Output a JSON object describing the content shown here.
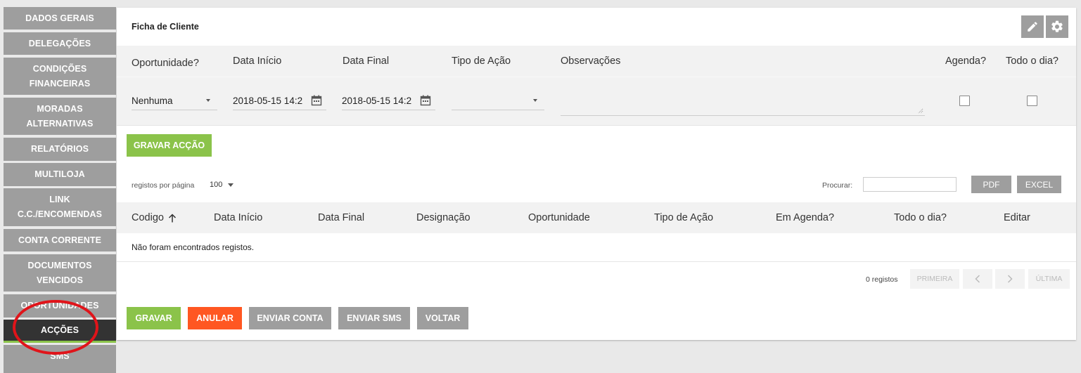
{
  "sidebar": {
    "items": [
      {
        "label": "DADOS GERAIS"
      },
      {
        "label": "DELEGAÇÕES"
      },
      {
        "label": "CONDIÇÕES FINANCEIRAS"
      },
      {
        "label": "MORADAS ALTERNATIVAS"
      },
      {
        "label": "RELATÓRIOS"
      },
      {
        "label": "MULTILOJA"
      },
      {
        "label": "LINK C.C./ENCOMENDAS"
      },
      {
        "label": "CONTA CORRENTE"
      },
      {
        "label": "DOCUMENTOS VENCIDOS"
      },
      {
        "label": "OPORTUNIDADES"
      },
      {
        "label": "ACÇÕES"
      },
      {
        "label": "SMS"
      }
    ]
  },
  "card": {
    "title": "Ficha de Cliente"
  },
  "form": {
    "headers": {
      "oportunidade": "Oportunidade?",
      "data_inicio": "Data Início",
      "data_final": "Data Final",
      "tipo_acao": "Tipo de Ação",
      "observacoes": "Observações",
      "agenda": "Agenda?",
      "todo_dia": "Todo o dia?"
    },
    "values": {
      "oportunidade": "Nenhuma",
      "data_inicio": "2018-05-15 14:2",
      "data_final": "2018-05-15 14:2",
      "tipo_acao": "",
      "observacoes": ""
    },
    "save_action_label": "GRAVAR ACÇÃO"
  },
  "table": {
    "per_page_label": "registos por página",
    "per_page_value": "100",
    "search_label": "Procurar:",
    "pdf_label": "PDF",
    "excel_label": "EXCEL",
    "columns": [
      "Codigo",
      "Data Início",
      "Data Final",
      "Designação",
      "Oportunidade",
      "Tipo de Ação",
      "Em Agenda?",
      "Todo o dia?",
      "Editar"
    ],
    "empty_message": "Não foram encontrados registos.",
    "count_label": "0 registos",
    "first_label": "PRIMEIRA",
    "last_label": "ÚLTIMA"
  },
  "actions": {
    "gravar": "GRAVAR",
    "anular": "ANULAR",
    "enviar_conta": "ENVIAR CONTA",
    "enviar_sms": "ENVIAR SMS",
    "voltar": "VOLTAR"
  },
  "colors": {
    "accent_green": "#8bc34a",
    "accent_orange": "#ff5722",
    "grey_button": "#9e9e9e",
    "active_sidebar": "#333333",
    "annotation_red": "#e0141a"
  }
}
